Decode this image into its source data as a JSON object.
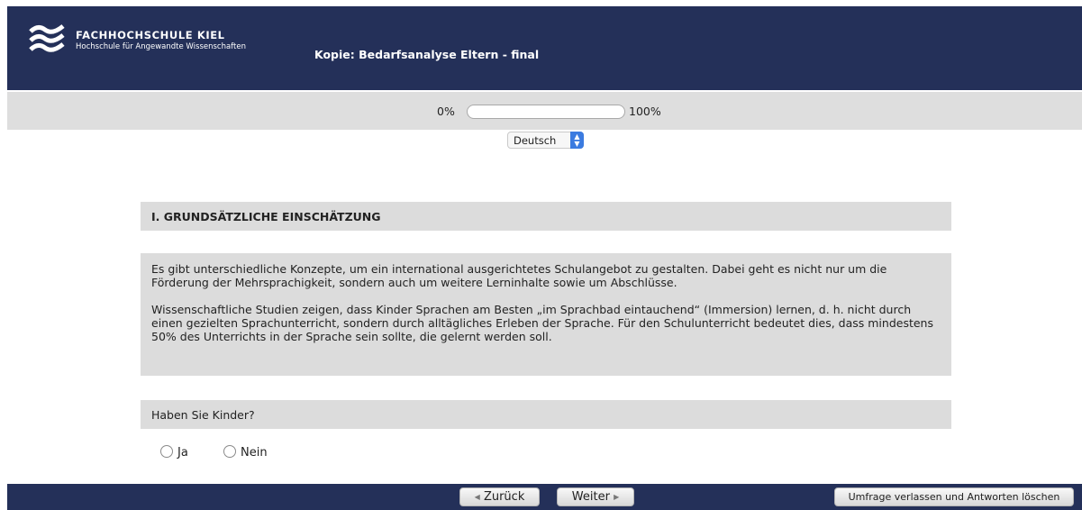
{
  "header": {
    "org_line1": "FACHHOCHSCHULE KIEL",
    "org_line2": "Hochschule für Angewandte Wissenschaften",
    "survey_title": "Kopie: Bedarfsanalyse Eltern - final",
    "background_color": "#243059"
  },
  "progress": {
    "start_label": "0%",
    "end_label": "100%",
    "value_percent": 0
  },
  "language": {
    "selected": "Deutsch"
  },
  "section": {
    "title": "I. GRUNDSÄTZLICHE EINSCHÄTZUNG"
  },
  "intro": {
    "paragraph1": "Es gibt unterschiedliche Konzepte, um ein international ausgerichtetes Schulangebot zu gestalten. Dabei geht es nicht nur um die Förderung der Mehrsprachigkeit, sondern auch um weitere Lerninhalte sowie um Abschlüsse.",
    "paragraph2": "Wissenschaftliche Studien zeigen, dass Kinder Sprachen am Besten „im Sprachbad eintauchend“ (Immersion) lernen, d. h. nicht durch einen gezielten Sprachunterricht, sondern durch alltägliches Erleben der Sprache. Für den Schulunterricht bedeutet dies, dass mindestens 50% des Unterrichts in der Sprache sein sollte, die gelernt werden soll."
  },
  "question": {
    "text": "Haben Sie Kinder?",
    "options": [
      "Ja",
      "Nein"
    ]
  },
  "footer": {
    "back_label": "Zurück",
    "next_label": "Weiter",
    "exit_label": "Umfrage verlassen und Antworten löschen"
  }
}
